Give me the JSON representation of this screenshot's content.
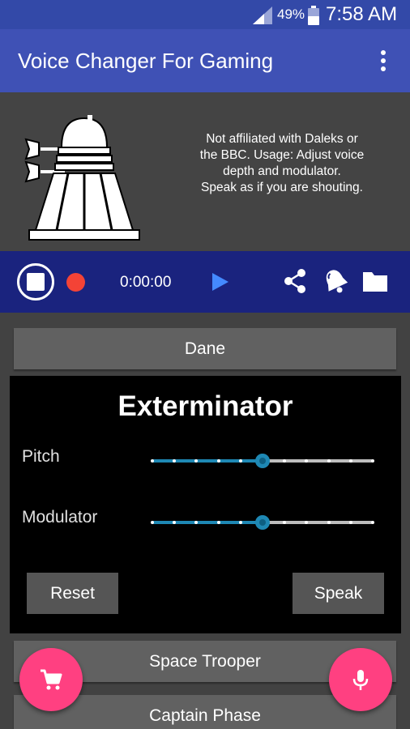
{
  "status_bar": {
    "battery": "49%",
    "time": "7:58 AM",
    "icons": [
      "signal-icon",
      "battery-icon"
    ]
  },
  "app_bar": {
    "title": "Voice Changer For Gaming",
    "overflow_icon": "more-vert-icon"
  },
  "header": {
    "logo_icon": "dalek-icon",
    "disclaimer": "Not affiliated with Daleks or\nthe BBC.  Usage: Adjust voice\ndepth and modulator.\nSpeak as if you are shouting."
  },
  "player": {
    "timer": "0:00:00",
    "icons": [
      "stop-icon",
      "record-icon",
      "play-icon",
      "share-icon",
      "bell-icon",
      "folder-icon"
    ],
    "record_color": "#f44336",
    "play_color": "#448aff"
  },
  "voices": {
    "top": "Dane",
    "below": [
      "Space Trooper",
      "Captain Phase"
    ]
  },
  "panel": {
    "title": "Exterminator",
    "pitch_label": "Pitch",
    "pitch_value": 0.5,
    "modulator_label": "Modulator",
    "modulator_value": 0.5,
    "slider_steps": 10,
    "reset_label": "Reset",
    "speak_label": "Speak"
  },
  "fabs": {
    "cart_icon": "cart-icon",
    "mic_icon": "mic-icon",
    "color": "#ff4081"
  },
  "colors": {
    "app_bar": "#3f51b5",
    "status_bar": "#3349a8",
    "player_bar": "#1a237e",
    "slider_accent": "#1e88b4"
  }
}
